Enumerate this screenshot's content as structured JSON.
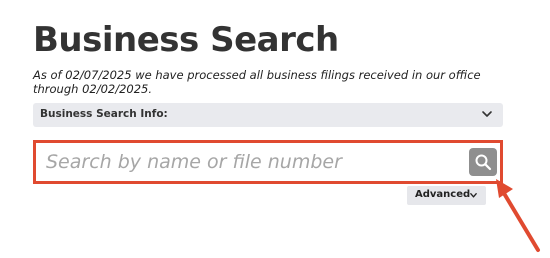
{
  "page": {
    "title": "Business Search",
    "notice": "As of 02/07/2025 we have processed all business filings received in our office through 02/02/2025."
  },
  "info_dropdown": {
    "label": "Business Search Info:",
    "icon": "chevron-down-icon"
  },
  "search": {
    "placeholder": "Search by name or file number",
    "value": "",
    "button_icon": "search-icon"
  },
  "advanced": {
    "label": "Advanced",
    "icon": "chevron-down-icon"
  },
  "colors": {
    "highlight": "#e04a30",
    "search_button": "#8f8f8f",
    "title": "#333333"
  }
}
